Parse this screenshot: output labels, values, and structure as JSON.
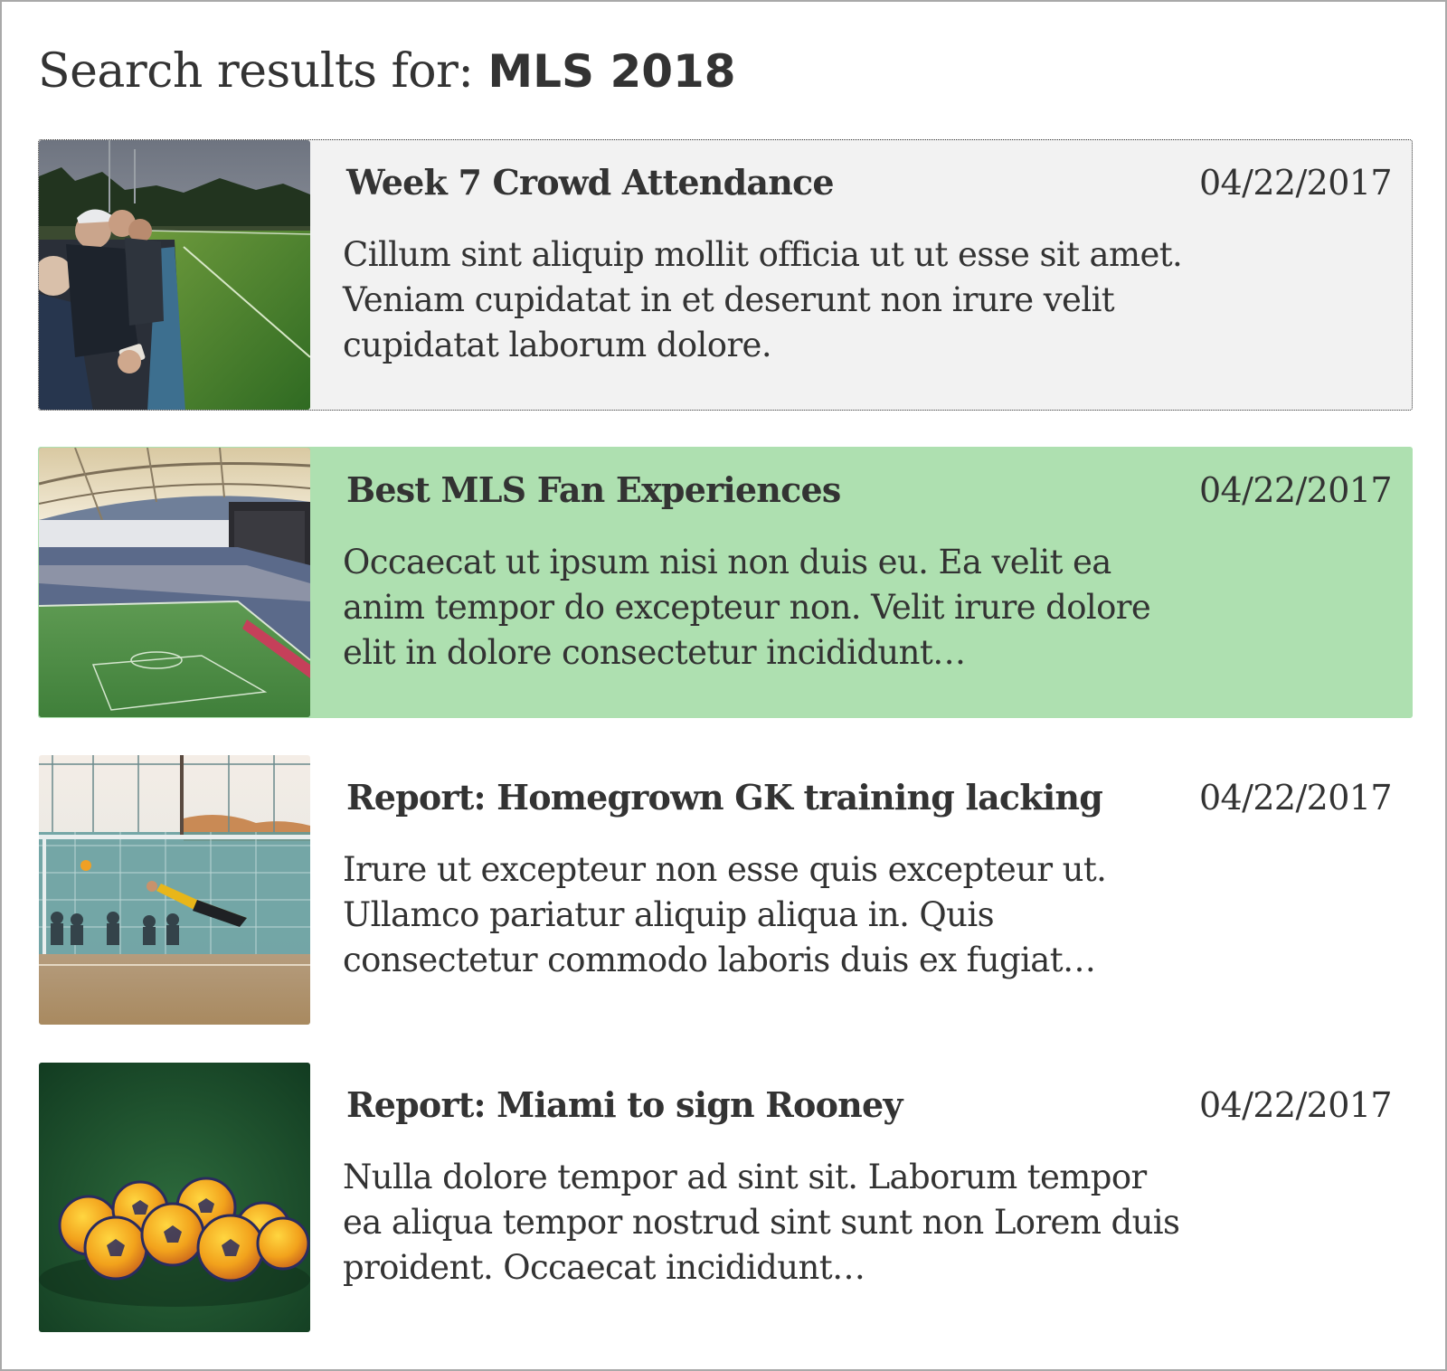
{
  "search": {
    "prefix": "Search results for: ",
    "query": "MLS 2018"
  },
  "results": [
    {
      "title": "Week 7 Crowd Attendance",
      "date": "04/22/2017",
      "snippet": "Cillum sint aliquip mollit officia ut ut esse sit amet. Veniam cupidatat in et deserunt non irure velit cupidatat laborum dolore.",
      "state": "focused",
      "image": "crowd-at-pitchside-image"
    },
    {
      "title": "Best MLS Fan Experiences",
      "date": "04/22/2017",
      "snippet": "Occaecat ut ipsum nisi non duis eu. Ea velit ea anim tempor do excepteur non. Velit irure dolore elit in dolore consectetur incididunt…",
      "state": "selected",
      "image": "stadium-image"
    },
    {
      "title": "Report: Homegrown GK training lacking",
      "date": "04/22/2017",
      "snippet": "Irure ut excepteur non esse quis excepteur ut. Ullamco pariatur aliquip aliqua in. Quis consectetur commodo laboris duis ex fugiat…",
      "state": "default",
      "image": "goalkeeper-dive-image"
    },
    {
      "title": "Report: Miami to sign Rooney",
      "date": "04/22/2017",
      "snippet": "Nulla dolore tempor ad sint sit. Laborum tempor ea aliqua tempor nostrud sint sunt non Lorem duis proident. Occaecat incididunt…",
      "state": "default",
      "image": "soccer-balls-image"
    }
  ],
  "colors": {
    "text": "#333333",
    "focused_background": "#f2f2f2",
    "selected_background": "#aee0b0",
    "frame_border": "#a9a9a9"
  }
}
